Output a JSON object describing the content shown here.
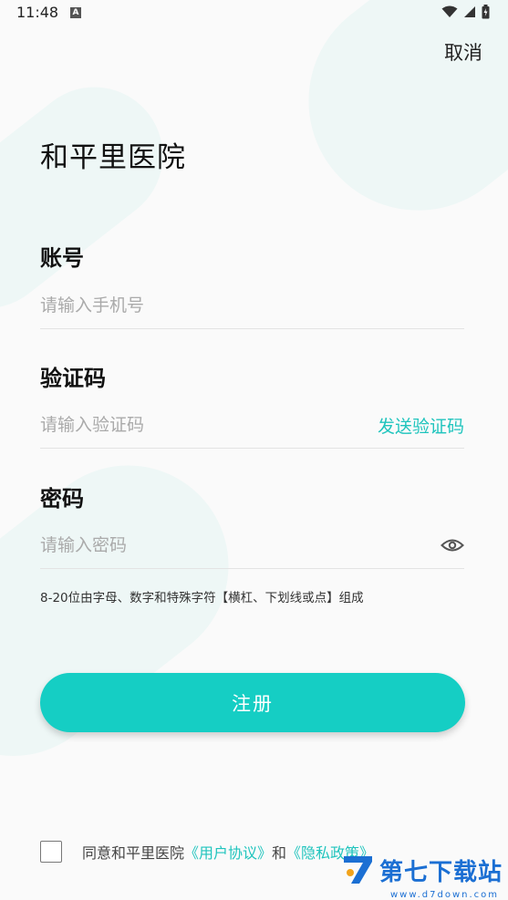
{
  "status_bar": {
    "time": "11:48",
    "notification_badge": "A"
  },
  "header": {
    "cancel_label": "取消"
  },
  "hospital_name": "和平里医院",
  "fields": {
    "account": {
      "label": "账号",
      "placeholder": "请输入手机号",
      "value": ""
    },
    "code": {
      "label": "验证码",
      "placeholder": "请输入验证码",
      "value": "",
      "send_label": "发送验证码"
    },
    "password": {
      "label": "密码",
      "placeholder": "请输入密码",
      "value": "",
      "hint": "8-20位由字母、数字和特殊字符【横杠、下划线或点】组成"
    }
  },
  "register_label": "注册",
  "agreement": {
    "prefix": "同意和平里医院",
    "user_agreement": "《用户协议》",
    "and": "和",
    "privacy_policy": "《隐私政策》"
  },
  "watermark": {
    "brand": "第七下载站",
    "url": "www.d7down.com"
  },
  "colors": {
    "accent": "#15cec4",
    "link": "#1fc4bd",
    "watermark": "#1b6fd3"
  },
  "icons": [
    "wifi-icon",
    "signal-icon",
    "battery-icon",
    "eye-icon",
    "checkbox-icon"
  ]
}
